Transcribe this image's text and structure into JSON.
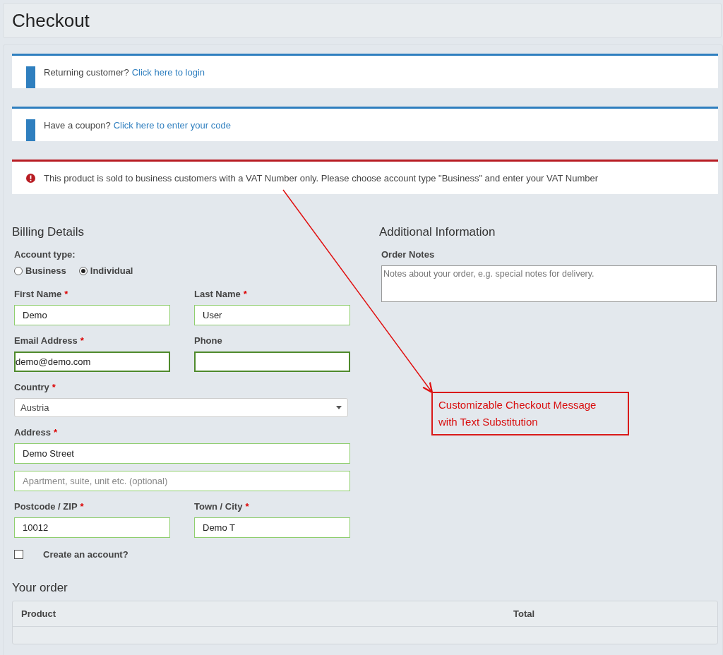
{
  "page": {
    "title": "Checkout"
  },
  "notices": [
    {
      "kind": "info",
      "text": "Returning customer?",
      "link": "Click here to login"
    },
    {
      "kind": "info",
      "text": "Have a coupon?",
      "link": "Click here to enter your code"
    },
    {
      "kind": "error",
      "text": "This product is sold to business customers with a VAT Number only. Please choose account type \"Business\" and enter your VAT Number"
    }
  ],
  "billing": {
    "title": "Billing Details",
    "account_type": {
      "label": "Account type:",
      "options": [
        {
          "label": "Business",
          "selected": false
        },
        {
          "label": "Individual",
          "selected": true
        }
      ]
    },
    "rows": [
      {
        "fields": [
          {
            "kind": "text",
            "label": "First Name",
            "required_mark": "*",
            "value": "Demo",
            "focused": false
          },
          {
            "kind": "text",
            "label": "Last Name",
            "required_mark": "*",
            "value": "User",
            "focused": false
          }
        ]
      },
      {
        "fields": [
          {
            "kind": "text",
            "label": "Email Address",
            "required_mark": "*",
            "value": "demo@demo.com",
            "focused": true
          },
          {
            "kind": "text",
            "label": "Phone",
            "focused": true
          }
        ]
      },
      {
        "fields": [
          {
            "kind": "select",
            "label": "Country",
            "required_mark": "*",
            "value": "Austria"
          }
        ]
      },
      {
        "fields": [
          {
            "kind": "text",
            "label": "Address",
            "required_mark": "*",
            "value": "Demo Street",
            "focused": false
          }
        ]
      },
      {
        "fields": [
          {
            "kind": "text",
            "placeholder": "Apartment, suite, unit etc. (optional)",
            "focused": false
          }
        ]
      },
      {
        "fields": [
          {
            "kind": "text",
            "label": "Postcode / ZIP",
            "required_mark": "*",
            "value": "10012",
            "focused": false
          },
          {
            "kind": "text",
            "label": "Town / City",
            "required_mark": "*",
            "value": "Demo T",
            "focused": false
          }
        ]
      }
    ],
    "create_account": {
      "label": "Create an account?",
      "checked": false
    }
  },
  "additional": {
    "title": "Additional Information",
    "notes_label": "Order Notes",
    "notes_placeholder": "Notes about your order, e.g. special notes for delivery."
  },
  "order": {
    "title": "Your order",
    "columns": [
      "Product",
      "Total"
    ]
  },
  "annotation": {
    "text": "Customizable Checkout Message\nwith Text Substitution"
  }
}
